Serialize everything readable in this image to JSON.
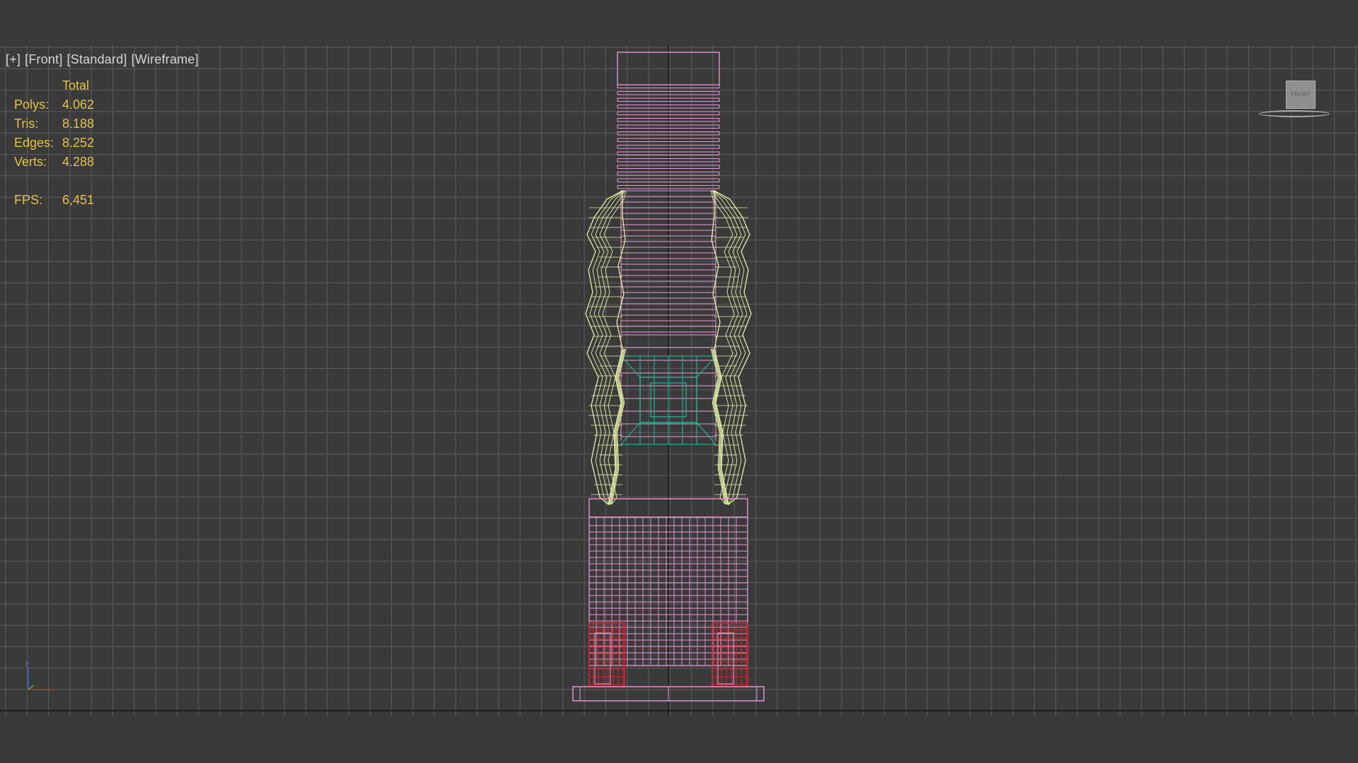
{
  "viewport": {
    "labels": [
      "[+]",
      "[Front]",
      "[Standard]",
      "[Wireframe]"
    ],
    "stats": {
      "header": "Total",
      "rows": [
        {
          "key": "Polys:",
          "value": "4.062"
        },
        {
          "key": "Tris:",
          "value": "8.188"
        },
        {
          "key": "Edges:",
          "value": "8.252"
        },
        {
          "key": "Verts:",
          "value": "4.288"
        }
      ],
      "fps": {
        "key": "FPS:",
        "value": "6,451"
      }
    },
    "viewcube": {
      "face_label": "FRONT"
    },
    "axis_tripod": {
      "z_label": "z"
    }
  },
  "colors": {
    "background": "#3a3a3a",
    "grid": "#5c5c5c",
    "ground_line": "#111111",
    "stats_text": "#e3c24a",
    "wire_pink": "#e89ad6",
    "wire_yellow": "#e4f0a6",
    "wire_teal": "#23c0a0",
    "wire_red": "#e0202a"
  },
  "icons": {
    "viewcube": "viewcube-icon",
    "axis": "axis-tripod-icon"
  }
}
